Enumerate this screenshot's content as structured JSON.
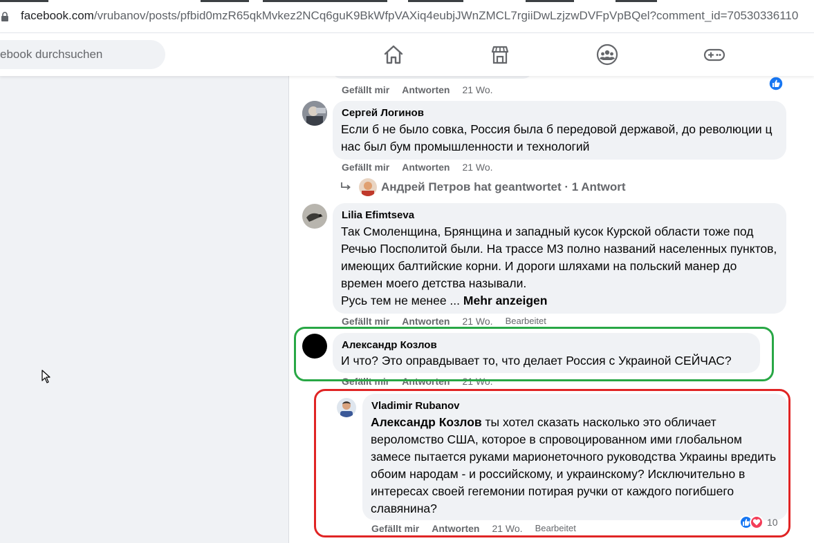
{
  "browser": {
    "url_domain": "facebook.com",
    "url_path": "/vrubanov/posts/pfbid0mzR65qkMvkez2NCq6guK9BkWfpVAXiq4eubjJWnZMCL7rgiiDwLzjzwDVFpVpBQel?comment_id=70530336110"
  },
  "nav": {
    "search_placeholder": "ebook durchsuchen",
    "icons": [
      "home-icon",
      "marketplace-icon",
      "groups-icon",
      "gaming-icon"
    ]
  },
  "colors": {
    "accent": "#1877f2",
    "green_highlight": "#28a745",
    "red_highlight": "#e02424",
    "love": "#f33e58"
  },
  "top_actions": {
    "like": "Gefällt mir",
    "reply": "Antworten",
    "time": "21 Wo."
  },
  "comments": [
    {
      "author": "Сергей Логинов",
      "text": "Если б не было совка, Россия была б передовой державой, до революции ц нас был бум промышленности и технологий",
      "like": "Gefällt mir",
      "reply": "Antworten",
      "time": "21 Wo.",
      "reply_summary": "Андрей Петров hat geantwortet · 1 Antwort"
    },
    {
      "author": "Lilia Efimtseva",
      "text": "Так Смоленщина, Брянщина и западный кусок Курской области тоже под Речью Посполитой были. На трассе М3 полно названий населенных пунктов, имеющих балтийские корни. И дороги шляхами на польский манер до времен моего детства называли.",
      "text_tail": "Русь тем не менее ...",
      "more": "Mehr anzeigen",
      "like": "Gefällt mir",
      "reply": "Antworten",
      "time": "21 Wo.",
      "edited": "Bearbeitet"
    },
    {
      "author": "Александр Козлов",
      "text": "И что? Это оправдывает то, что делает Россия с Украиной СЕЙЧАС?",
      "like": "Gefällt mir",
      "reply": "Antworten",
      "time": "21 Wo."
    },
    {
      "author": "Vladimir Rubanov",
      "mention": "Александр Козлов",
      "text": " ты хотел сказать насколько это обличает вероломство США, которое в спровоцированном ими глобальном замесе пытается руками марионеточного руководства Украины вредить обоим народам - и российскому, и украинскому? Исключительно в интересах своей гегемонии потирая ручки от каждого погибшего славянина?",
      "like": "Gefällt mir",
      "reply": "Antworten",
      "time": "21 Wo.",
      "edited": "Bearbeitet",
      "reaction_count": "10"
    }
  ]
}
